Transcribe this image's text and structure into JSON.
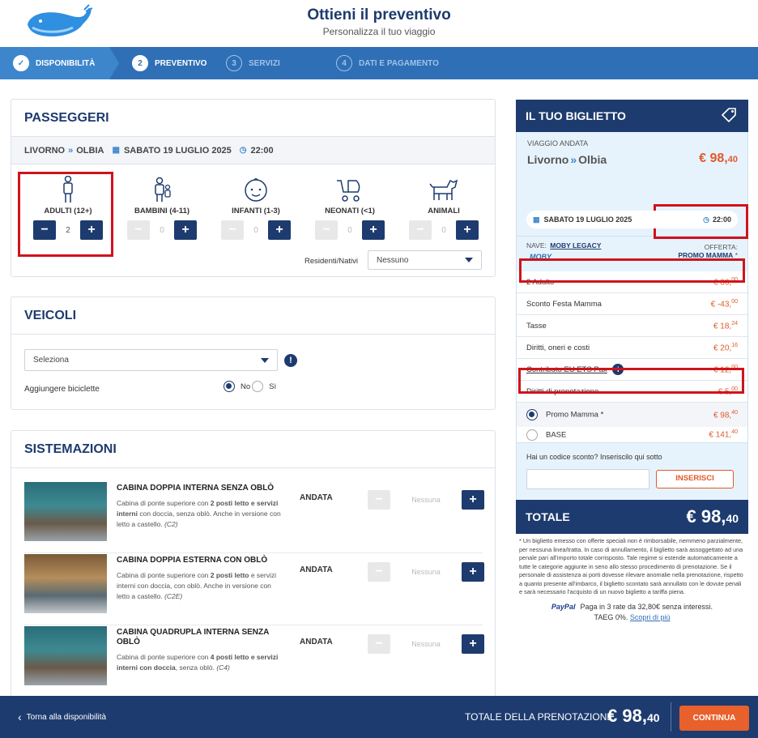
{
  "header": {
    "title": "Ottieni il preventivo",
    "subtitle": "Personalizza il tuo viaggio"
  },
  "steps": [
    {
      "num": "✓",
      "label": "DISPONIBILITÀ"
    },
    {
      "num": "2",
      "label": "PREVENTIVO"
    },
    {
      "num": "3",
      "label": "SERVIZI"
    },
    {
      "num": "4",
      "label": "DATI E PAGAMENTO"
    }
  ],
  "passengers": {
    "title": "PASSEGGERI",
    "from": "LIVORNO",
    "to": "OLBIA",
    "date": "SABATO 19 LUGLIO 2025",
    "time": "22:00",
    "types": [
      {
        "label": "ADULTI (12+)",
        "value": "2"
      },
      {
        "label": "BAMBINI (4-11)",
        "value": "0"
      },
      {
        "label": "INFANTI (1-3)",
        "value": "0"
      },
      {
        "label": "NEONATI (<1)",
        "value": "0"
      },
      {
        "label": "ANIMALI",
        "value": "0"
      }
    ],
    "residents_label": "Residenti/Nativi",
    "residents_value": "Nessuno"
  },
  "vehicles": {
    "title": "VEICOLI",
    "select_value": "Seleziona",
    "bikes_label": "Aggiungere biciclette",
    "no": "No",
    "yes": "Sì"
  },
  "cabins": {
    "title": "SISTEMAZIONI",
    "items": [
      {
        "title": "CABINA DOPPIA INTERNA SENZA OBLÒ",
        "d1": "Cabina di ponte superiore con ",
        "b1": "2 posti letto e servizi interni",
        "d2": " con doccia, senza oblò. Anche in versione con letto a castello. ",
        "code": "(C2)",
        "dir": "ANDATA",
        "value": "Nessuna"
      },
      {
        "title": "CABINA DOPPIA ESTERNA CON OBLÒ",
        "d1": "Cabina di ponte superiore con ",
        "b1": "2 posti letto",
        "d2": " e servizi interni con doccia, con oblò. Anche in versione con letto a castello. ",
        "code": "(C2E)",
        "dir": "ANDATA",
        "value": "Nessuna"
      },
      {
        "title": "CABINA QUADRUPLA INTERNA SENZA OBLÒ",
        "d1": "Cabina di ponte superiore con ",
        "b1": "4 posti letto e servizi interni con doccia",
        "d2": ", senza oblò. ",
        "code": "(C4)",
        "dir": "ANDATA",
        "value": "Nessuna"
      }
    ]
  },
  "ticket": {
    "title": "IL TUO BIGLIETTO",
    "trip_label": "VIAGGIO ANDATA",
    "from": "Livorno",
    "to": "Olbia",
    "price_int": "€ 98,",
    "price_dec": "40",
    "date": "SABATO 19 LUGLIO 2025",
    "time": "22:00",
    "ship_label": "NAVE:",
    "ship_name": "MOBY LEGACY",
    "brand": "MOBY",
    "offer_label": "OFFERTA:",
    "offer_name": "PROMO MAMMA",
    "offer_star": "*",
    "lines": [
      {
        "label": "2 Adulto",
        "int": "€ 86,",
        "dec": "00"
      },
      {
        "label": "Sconto Festa Mamma",
        "int": "€ -43,",
        "dec": "00"
      },
      {
        "label": "Tasse",
        "int": "€ 18,",
        "dec": "24"
      },
      {
        "label": "Diritti, oneri e costi",
        "int": "€ 20,",
        "dec": "16"
      },
      {
        "label": "Contributo EU ETS Pax",
        "int": "€ 12,",
        "dec": "00"
      },
      {
        "label": "Diritti di prenotazione",
        "int": "€ 5,",
        "dec": "00"
      }
    ],
    "fares": [
      {
        "label": "Promo Mamma *",
        "int": "€ 98,",
        "dec": "40"
      },
      {
        "label": "BASE",
        "int": "€ 141,",
        "dec": "40"
      }
    ],
    "promo_question": "Hai un codice sconto? Inseriscilo qui sotto",
    "insert_label": "INSERISCI",
    "total_label": "TOTALE",
    "total_int": "€ 98,",
    "total_dec": "40",
    "disclaimer": "* Un biglietto emesso con offerte speciali non è rimborsabile, nemmeno parzialmente, per nessuna linea/tratta. In caso di annullamento, il biglietto sarà assoggettato ad una penale pari all'importo totale corrisposto. Tale regime si estende automaticamente a tutte le categorie aggiunte in seno allo stesso procedimento di prenotazione. Se il personale di assistenza ai porti dovesse rilevare anomalie nella prenotazione, rispetto a quanto presente all'imbarco, il biglietto scontato sarà annullato con le dovute penali e sarà necessario l'acquisto di un nuovo biglietto a tariffa piena.",
    "paypal": "PayPal",
    "paypal_text": "Paga in 3 rate da 32,80€ senza interessi.",
    "taeg": "TAEG 0%.",
    "more": "Scopri di più"
  },
  "footer": {
    "back": "Torna alla disponibilità",
    "total_label": "TOTALE DELLA PRENOTAZIONE",
    "total_int": "€ 98,",
    "total_dec": "40",
    "continue": "CONTINUA"
  }
}
